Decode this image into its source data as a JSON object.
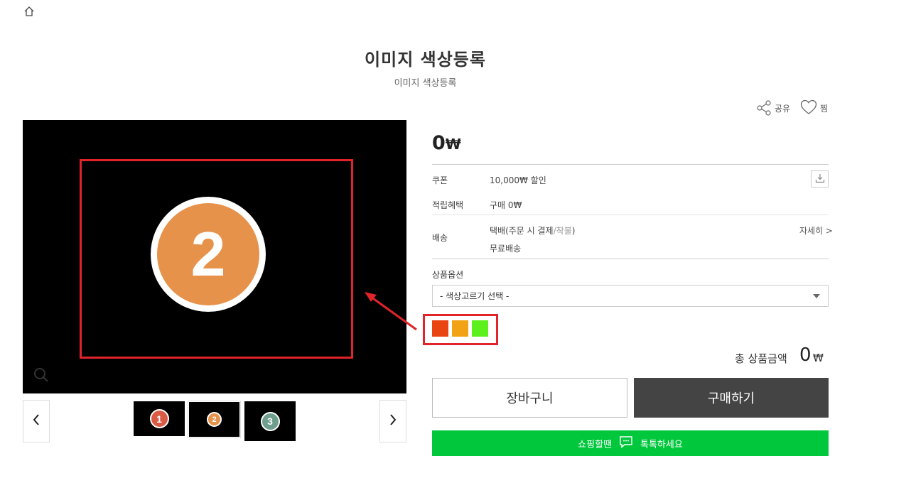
{
  "header": {
    "home_icon": "home-icon"
  },
  "product": {
    "title": "이미지 색상등록",
    "subtitle": "이미지 색상등록",
    "price_value": "0",
    "price_unit": "₩"
  },
  "actions": {
    "share_label": "공유",
    "wish_label": "찜"
  },
  "main_image": {
    "number": "2",
    "circle_color": "#e6924a"
  },
  "thumbnails": [
    {
      "number": "1",
      "color": "#d95b45"
    },
    {
      "number": "2",
      "color": "#e6924a"
    },
    {
      "number": "3",
      "color": "#6e9e8c"
    }
  ],
  "info": {
    "coupon_label": "쿠폰",
    "coupon_value": "10,000₩ 할인",
    "points_label": "적립혜택",
    "points_value": "구매 0₩",
    "shipping_label": "배송",
    "shipping_method": "택배(",
    "shipping_method_pay": "주문 시 결제",
    "shipping_method_sep": "/",
    "shipping_method_cod": "착불",
    "shipping_method_end": ")",
    "shipping_fee": "무료배송",
    "detail_link": "자세히 >"
  },
  "options": {
    "label": "상품옵션",
    "select_placeholder": "- 색상고르기 선택 -",
    "swatches": [
      "#e84512",
      "#f2a315",
      "#5ef01c"
    ]
  },
  "total": {
    "label": "총 상품금액",
    "value": "0",
    "unit": "₩"
  },
  "buttons": {
    "cart": "장바구니",
    "buy": "구매하기"
  },
  "talk": {
    "prefix": "쇼핑할땐",
    "suffix": "톡톡하세요"
  },
  "colors": {
    "accent_red": "#e0242a",
    "talk_green": "#00c73c",
    "buy_dark": "#444444"
  }
}
